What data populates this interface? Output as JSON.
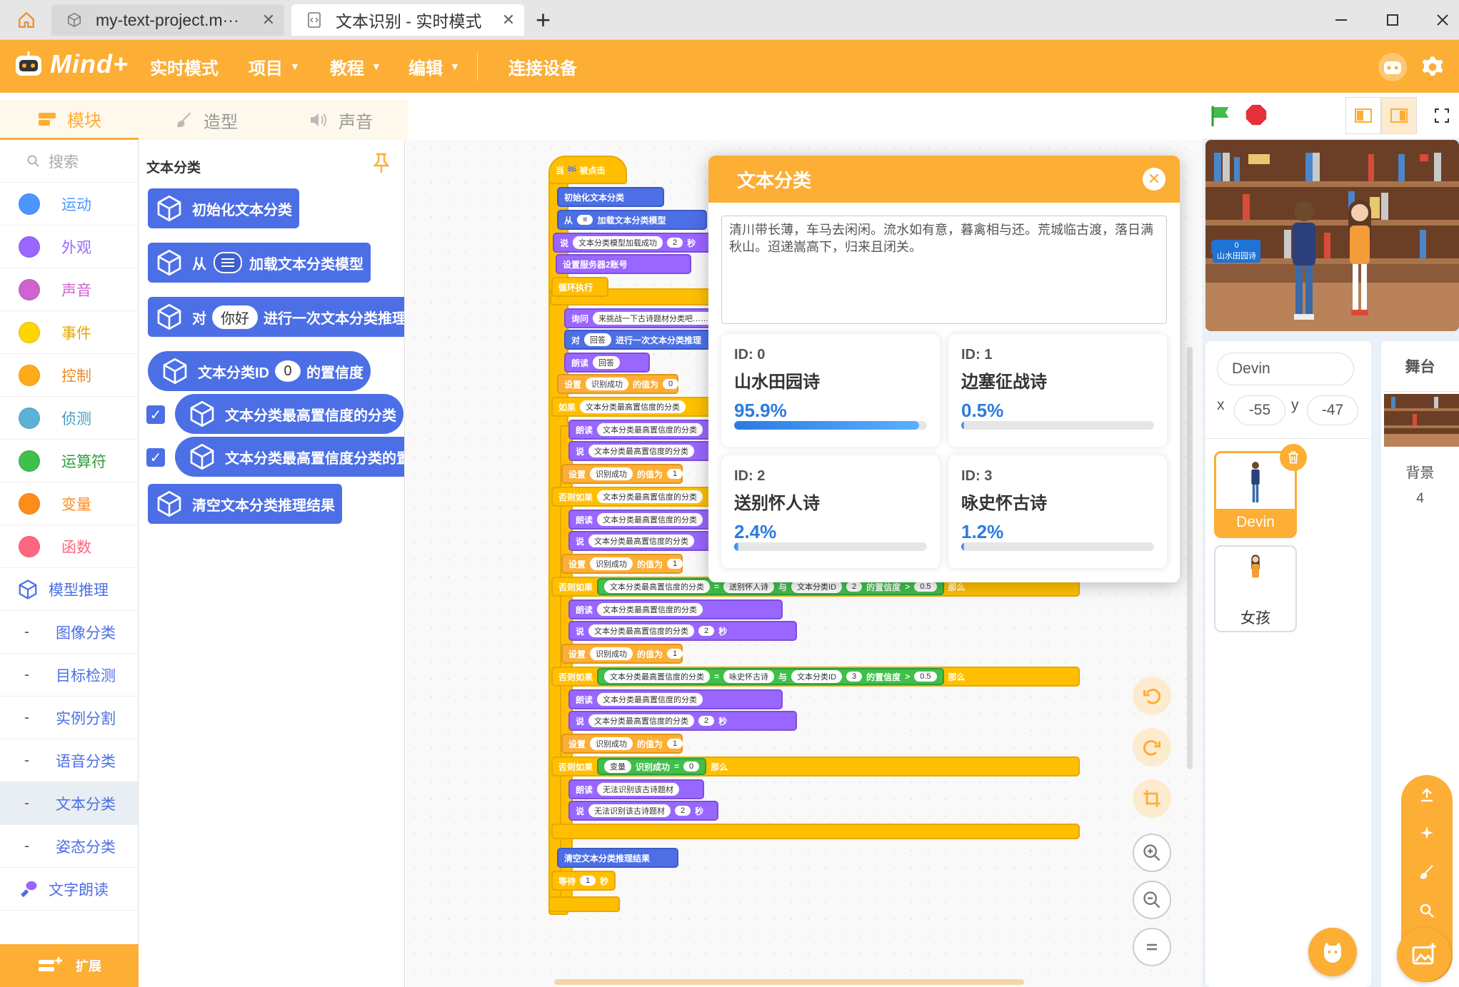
{
  "tabs": [
    {
      "label": "my-text-project.m···"
    },
    {
      "label": "文本识别 - 实时模式"
    }
  ],
  "menu": {
    "logo": "Mind+",
    "realtime": "实时模式",
    "project": "项目",
    "tutorial": "教程",
    "edit": "编辑",
    "connect": "连接设备"
  },
  "content_tabs": {
    "blocks": "模块",
    "costumes": "造型",
    "sounds": "声音"
  },
  "categories": {
    "search_placeholder": "搜索",
    "items": [
      {
        "label": "运动",
        "color": "#4c97ff"
      },
      {
        "label": "外观",
        "color": "#9966ff"
      },
      {
        "label": "声音",
        "color": "#cf63cf"
      },
      {
        "label": "事件",
        "color": "#ffd500"
      },
      {
        "label": "控制",
        "color": "#ffab19"
      },
      {
        "label": "侦测",
        "color": "#5cb1d6"
      },
      {
        "label": "运算符",
        "color": "#40bf4a"
      },
      {
        "label": "变量",
        "color": "#ff8c1a"
      },
      {
        "label": "函数",
        "color": "#ff6680"
      }
    ],
    "model": "模型推理",
    "subs": [
      "图像分类",
      "目标检测",
      "实例分割",
      "语音分类",
      "文本分类",
      "姿态分类"
    ],
    "tts": "文字朗读",
    "extension": "扩展"
  },
  "palette": {
    "title": "文本分类",
    "b1": "初始化文本分类",
    "b2_a": "从",
    "b2_b": "加载文本分类模型",
    "b3_a": "对",
    "b3_slot": "你好",
    "b3_b": "进行一次文本分类推理",
    "b4_a": "文本分类ID",
    "b4_num": "0",
    "b4_b": "的置信度",
    "b5": "文本分类最高置信度的分类",
    "b6": "文本分类最高置信度分类的置信度",
    "b7": "清空文本分类推理结果"
  },
  "script": {
    "hat": "当 🏁 被点击",
    "init": "初始化文本分类",
    "load_a": "从",
    "load_b": "加载文本分类模型",
    "say": "说",
    "loaded": "文本分类模型加载成功",
    "n2": "2",
    "sec": "秒",
    "server": "设置服务器2账号",
    "loop": "循环执行",
    "ask": "询问",
    "ask_q": "来挑战一下古诗题材分类吧……",
    "infer_a": "对",
    "answer": "回答",
    "infer_b": "进行一次文本分类推理",
    "read": "朗读",
    "set": "设置",
    "var": "识别成功",
    "to": "的值为",
    "n0": "0",
    "n1": "1",
    "if": "如果",
    "elif": "否则如果",
    "top": "文本分类最高置信度的分类",
    "eq": "=",
    "and": "与",
    "idconf": "文本分类ID",
    "conf": "的置信度",
    "gt": ">",
    "th": "0.5",
    "then": "那么",
    "cat2": "送别怀人诗",
    "cat3": "咏史怀古诗",
    "n3": "3",
    "var_label": "变量",
    "fail": "无法识别该古诗题材",
    "clear": "清空文本分类推理结果",
    "wait": "等待"
  },
  "modal": {
    "title": "文本分类",
    "text": "清川带长薄，车马去闲闲。流水如有意，暮禽相与还。荒城临古渡，落日满秋山。迢递嵩高下，归来且闭关。",
    "results": [
      {
        "id": "ID: 0",
        "name": "山水田园诗",
        "pct": "95.9%",
        "value": 95.9
      },
      {
        "id": "ID: 1",
        "name": "边塞征战诗",
        "pct": "0.5%",
        "value": 0.5
      },
      {
        "id": "ID: 2",
        "name": "送别怀人诗",
        "pct": "2.4%",
        "value": 2.4
      },
      {
        "id": "ID: 3",
        "name": "咏史怀古诗",
        "pct": "1.2%",
        "value": 1.2
      }
    ]
  },
  "stage": {
    "var_value": "0",
    "var_name": "山水田园诗",
    "label": "舞台",
    "backdrop_label": "背景",
    "backdrop_count": "4"
  },
  "sprite": {
    "name": "Devin",
    "x_label": "x",
    "x": "-55",
    "y_label": "y",
    "y": "-47",
    "list": [
      "Devin",
      "女孩"
    ]
  },
  "colors": {
    "accent": "#fcae35",
    "block_blue": "#4c6fe6",
    "progress": "#2b7be0"
  }
}
